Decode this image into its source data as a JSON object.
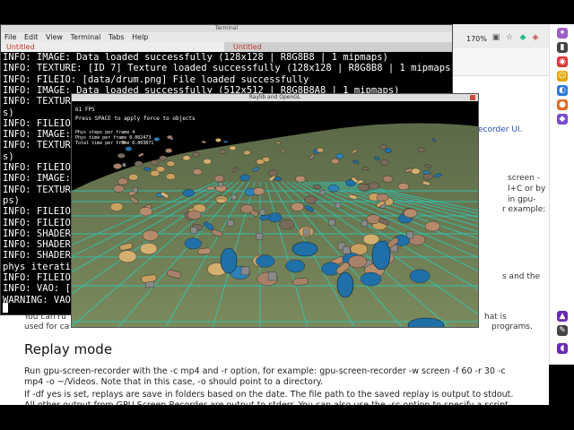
{
  "terminal": {
    "title": "Terminal",
    "menu": [
      "File",
      "Edit",
      "View",
      "Terminal",
      "Tabs",
      "Help"
    ],
    "tabs": [
      {
        "label": "Untitled"
      },
      {
        "label": "Untitled"
      }
    ],
    "lines": [
      "INFO: IMAGE: Data loaded successfully (128x128 | R8G8B8 | 1 mipmaps)",
      "INFO: TEXTURE: [ID 7] Texture loaded successfully (128x128 | R8G8B8 | 1 mipmaps)",
      "INFO: FILEIO: [data/drum.png] File loaded successfully",
      "INFO: IMAGE: Data loaded successfully (512x512 | R8G8B8A8 | 1 mipmaps)",
      "INFO: TEXTUR",
      "s)",
      "INFO: FILEIO",
      "INFO: IMAGE:",
      "INFO: TEXTUR",
      "s)",
      "INFO: FILEIO",
      "INFO: IMAGE:",
      "INFO: TEXTUR",
      "ps)",
      "INFO: FILEIO",
      "INFO: FILEIO",
      "INFO: SHADER",
      "INFO: SHADER",
      "INFO: SHADER",
      "phys iteratio",
      "INFO: FILEIO",
      "INFO: VAO: [",
      "WARNING: VAO"
    ]
  },
  "raylib": {
    "title": "Raylib and OpenGL",
    "fps": "61 FPS",
    "hint": "Press SPACE to apply force to objects",
    "stats": [
      "Phys steps per frame 4",
      "Phys time per frame 0.002473",
      "Total time per frame 0.003871"
    ]
  },
  "browser": {
    "zoom": "170%",
    "fragments": {
      "recorder": "ecorder UI.",
      "screen": "screen -",
      "ctrl": "l+C or by",
      "gpu": "in gpu-",
      "example": "r example:",
      "and_the": "s and the",
      "that_is": "hat is",
      "programs": "programs."
    },
    "overlap_line_1": "You can ru",
    "overlap_line_2": "used for ca",
    "section_title": "Replay mode",
    "para1": "Run gpu-screen-recorder with the -c mp4 and -r option, for example: gpu-screen-recorder -w screen -f 60 -r 30 -c mp4 -o ~/Videos. Note that in this case, -o should point to a directory.",
    "para2": "If -df yes is set, replays are save in folders based on the date. The file path to the saved replay is output to stdout.",
    "para3": "All other output from GPU Screen Recorder are output to stderr. You can also use the -sc option to specify a script"
  },
  "colors": {
    "grid": "#23d3c6",
    "barrel_blue": "#1f6fa8",
    "capsule_tan": "#b78b6c",
    "crate": "#7a6a5a",
    "ground": "#6d7a52"
  }
}
